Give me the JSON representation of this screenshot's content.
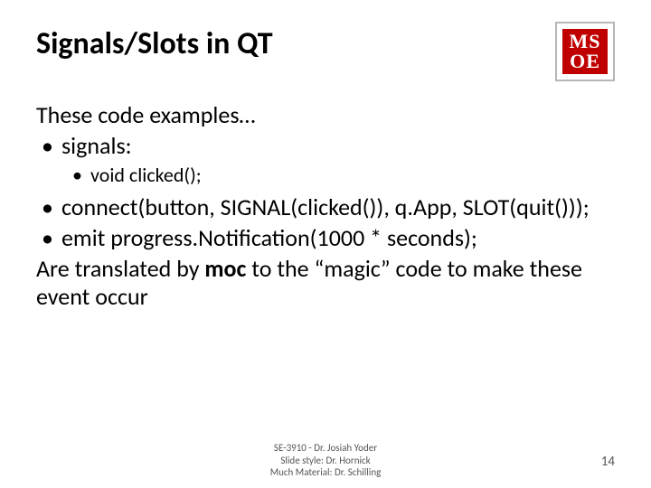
{
  "title": "Signals/Slots in QT",
  "logo": {
    "top": "MS",
    "bottom": "OE"
  },
  "lines": {
    "intro": "These code examples…",
    "b1": "signals:",
    "b1a": "void clicked();",
    "b2": "connect(button, SIGNAL(clicked()), q.App, SLOT(quit()));",
    "b3": "emit progress.Notification(1000 * seconds);",
    "outro_pre": "Are translated by ",
    "outro_moc": "moc",
    "outro_post": " to the “magic” code to make these event occur"
  },
  "footer": {
    "l1": "SE-3910  -  Dr. Josiah Yoder",
    "l2": "Slide style: Dr. Hornick",
    "l3": "Much Material: Dr. Schilling"
  },
  "page": "14"
}
